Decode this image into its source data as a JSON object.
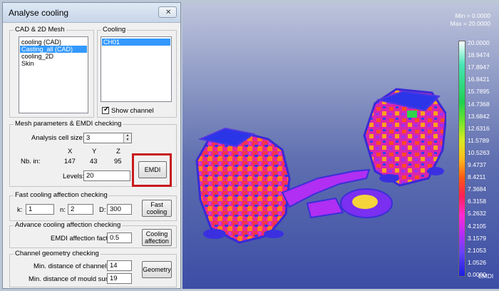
{
  "dialog": {
    "title": "Analyse cooling",
    "close_label": "✕"
  },
  "mesh_group": {
    "label": "CAD & 2D Mesh",
    "items": [
      "cooling (CAD)",
      "Casting_all (CAD)",
      "cooling_2D",
      "Skin"
    ],
    "selected_index": 1
  },
  "cooling_group": {
    "label": "Cooling",
    "items": [
      "CH01"
    ],
    "show_channel_label": "Show channel",
    "show_channel_checked": true
  },
  "mesh_params": {
    "label": "Mesh parameters & EMDI checking",
    "cell_size_label": "Analysis cell size:",
    "cell_size_value": "3",
    "axis_x": "X",
    "axis_y": "Y",
    "axis_z": "Z",
    "nb_in_label": "Nb. in:",
    "nb_x": "147",
    "nb_y": "43",
    "nb_z": "95",
    "levels_label": "Levels:",
    "levels_value": "20",
    "emdi_button": "EMDI"
  },
  "fast_cooling": {
    "label": "Fast cooling affection checking",
    "k_label": "k:",
    "k_value": "1",
    "n_label": "n:",
    "n_value": "2",
    "d_label": "D:",
    "d_value": "300",
    "button_line1": "Fast",
    "button_line2": "cooling"
  },
  "advance_cooling": {
    "label": "Advance cooling affection checking",
    "factor_label": "EMDI affection factor:",
    "factor_value": "0.5",
    "button_line1": "Cooling",
    "button_line2": "affection"
  },
  "channel_geometry": {
    "label": "Channel geometry checking",
    "min_channel_label": "Min. distance of channel:",
    "min_channel_value": "14",
    "min_mould_label": "Min. distance of mould surface:",
    "min_mould_value": "19",
    "button": "Geometry"
  },
  "viewport": {
    "min_text": "Min =  0.0000",
    "max_text": "Max =  20.0000",
    "colorbar_title": "EMDI",
    "ticks": [
      "20.0000",
      "18.9474",
      "17.8947",
      "16.8421",
      "15.7895",
      "14.7368",
      "13.6842",
      "12.6316",
      "11.5789",
      "10.5263",
      "9.4737",
      "8.4211",
      "7.3684",
      "6.3158",
      "5.2632",
      "4.2105",
      "3.1579",
      "2.1053",
      "1.0526",
      "0.0000"
    ]
  },
  "colors": {
    "highlight": "#c8191d",
    "selection": "#3399ff"
  }
}
